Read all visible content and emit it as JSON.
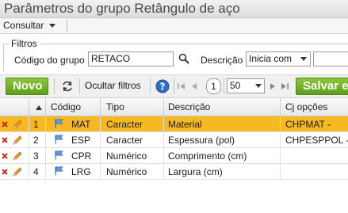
{
  "window": {
    "title": "Parâmetros do grupo Retângulo de aço"
  },
  "menu": {
    "items": [
      {
        "label": "Consultar",
        "icon": "chevron-down-icon"
      }
    ]
  },
  "filters": {
    "legend": "Filtros",
    "group_code_label": "Código do grupo",
    "group_code_value": "RETACO",
    "description_label": "Descrição",
    "description_mode": "Inicia com",
    "description_value": ""
  },
  "toolbar": {
    "new_label": "Novo",
    "hide_filters_label": "Ocultar filtros",
    "page_number": "1",
    "page_size": "50",
    "save_label": "Salvar e"
  },
  "table": {
    "columns": [
      "Código",
      "Tipo",
      "Descrição",
      "Cj opções"
    ],
    "rows": [
      {
        "n": "1",
        "code": "MAT",
        "type": "Caracter",
        "desc": "Material",
        "opts": "CHPMAT -",
        "selected": true
      },
      {
        "n": "2",
        "code": "ESP",
        "type": "Caracter",
        "desc": "Espessura (pol)",
        "opts": "CHPESPPOL -",
        "selected": false
      },
      {
        "n": "3",
        "code": "CPR",
        "type": "Numérico",
        "desc": "Comprimento (cm)",
        "opts": "",
        "selected": false
      },
      {
        "n": "4",
        "code": "LRG",
        "type": "Numérico",
        "desc": "Largura (cm)",
        "opts": "",
        "selected": false
      }
    ]
  },
  "colors": {
    "accent_green": "#6aab22",
    "selected_row": "#f6b921",
    "help_blue": "#2f6fc2"
  }
}
